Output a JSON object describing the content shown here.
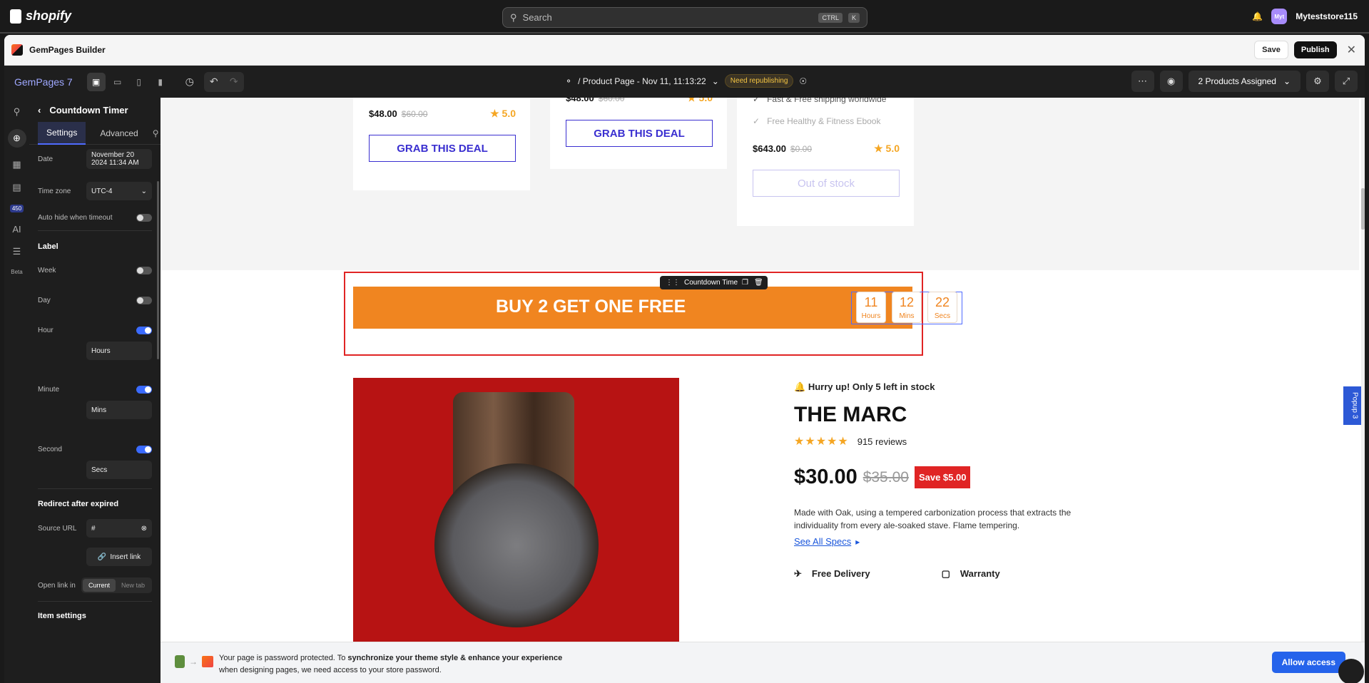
{
  "shopify": {
    "brand": "shopify",
    "search_placeholder": "Search",
    "kbd_ctrl": "CTRL",
    "kbd_k": "K",
    "avatar_initials": "Myt",
    "store_name": "Myteststore115"
  },
  "builder": {
    "title": "GemPages Builder",
    "save": "Save",
    "publish": "Publish"
  },
  "toolbar": {
    "project": "GemPages 7",
    "page": "/ Product Page - Nov 11, 11:13:22",
    "status": "Need republishing",
    "assigned": "2 Products Assigned"
  },
  "rail": {
    "badge": "450",
    "ai": "AI",
    "beta": "Beta"
  },
  "panel": {
    "title": "Countdown Timer",
    "tabs": [
      "Settings",
      "Advanced"
    ],
    "date_label": "Date",
    "date_value": "November 20 2024 11:34 AM",
    "timezone_label": "Time zone",
    "timezone_value": "UTC-4",
    "autohide_label": "Auto hide when timeout",
    "label_section": "Label",
    "week": "Week",
    "day": "Day",
    "hour": "Hour",
    "hour_value": "Hours",
    "minute": "Minute",
    "minute_value": "Mins",
    "second": "Second",
    "second_value": "Secs",
    "redirect_section": "Redirect after expired",
    "source_url_label": "Source URL",
    "source_url_value": "#",
    "insert_link": "Insert link",
    "open_link_label": "Open link in",
    "open_current": "Current",
    "open_new": "New tab",
    "item_settings": "Item settings",
    "toggles": {
      "autohide": false,
      "week": false,
      "day": false,
      "hour": true,
      "minute": true,
      "second": true
    }
  },
  "cards": [
    {
      "price": "$48.00",
      "old": "$60.00",
      "rating": "5.0",
      "button": "GRAB THIS DEAL"
    },
    {
      "price": "$48.00",
      "old": "$60.00",
      "rating": "5.0",
      "button": "GRAB THIS DEAL"
    },
    {
      "feature1": "Fast & Free shipping worldwide",
      "feature2": "Free Healthy & Fitness Ebook",
      "price": "$643.00",
      "old": "$0.00",
      "rating": "5.0",
      "button": "Out of stock"
    }
  ],
  "banner": {
    "text": "BUY 2 GET ONE FREE",
    "hours": "11",
    "hours_label": "Hours",
    "mins": "12",
    "mins_label": "Mins",
    "secs": "22",
    "secs_label": "Secs",
    "element_label": "Countdown Timer"
  },
  "popup_tab": "Popup 3",
  "product": {
    "stock": "Hurry up! Only 5 left in stock",
    "title": "THE MARC",
    "reviews": "915 reviews",
    "price": "$30.00",
    "old_price": "$35.00",
    "save": "Save $5.00",
    "description": "Made with Oak, using a tempered carbonization process that extracts the individuality from every ale-soaked stave. Flame tempering.",
    "specs": "See All Specs",
    "delivery": "Free Delivery",
    "warranty": "Warranty"
  },
  "infobar": {
    "line1_a": "Your page is password protected. To ",
    "line1_b": "synchronize your theme style & enhance your experience",
    "line2": "when designing pages, we need access to your store password.",
    "button": "Allow access"
  },
  "colors": {
    "accent": "#4f6bff",
    "banner": "#f08520",
    "deal": "#3a2fd0",
    "sale": "#e02424",
    "allow": "#2563eb"
  }
}
